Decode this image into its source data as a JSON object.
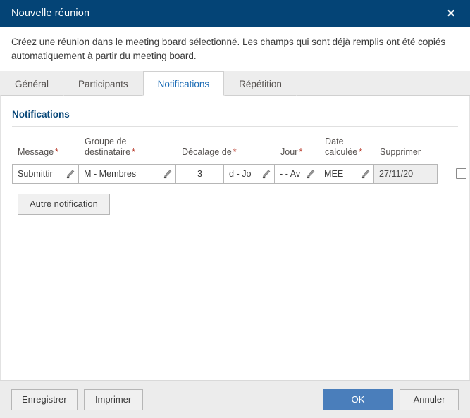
{
  "window": {
    "title": "Nouvelle réunion",
    "close_icon": "close-icon",
    "close_glyph": "✕"
  },
  "description": "Créez une réunion dans le meeting board sélectionné. Les champs qui sont déjà remplis ont été copiés automatiquement à partir du meeting board.",
  "tabs": [
    {
      "label": "Général",
      "active": false
    },
    {
      "label": "Participants",
      "active": false
    },
    {
      "label": "Notifications",
      "active": true
    },
    {
      "label": "Répétition",
      "active": false
    }
  ],
  "section": {
    "title": "Notifications"
  },
  "table": {
    "headers": [
      {
        "label": "Message",
        "required": true
      },
      {
        "label": "Groupe de destinataire",
        "required": true
      },
      {
        "label": "Décalage de",
        "required": true
      },
      {
        "label": "",
        "required": false
      },
      {
        "label": "Jour",
        "required": true
      },
      {
        "label": "Date calculée",
        "required": true
      },
      {
        "label": "Supprimer",
        "required": false
      }
    ],
    "rows": [
      {
        "message": "Submittir",
        "recipient_group": "M - Membres",
        "offset_number": "3",
        "offset_unit": "d - Jo",
        "direction": "- - Av",
        "day": "MEE",
        "calculated_date": "27/11/20",
        "delete_checked": false
      }
    ]
  },
  "actions": {
    "add_notification": "Autre notification"
  },
  "footer": {
    "save": "Enregistrer",
    "print": "Imprimer",
    "ok": "OK",
    "cancel": "Annuler"
  },
  "colors": {
    "titlebar": "#044476",
    "accent": "#1a6bb5",
    "primary_button": "#4a7ebb",
    "required_marker": "#b83a2b",
    "section_heading": "#044476"
  },
  "icons": {
    "edit": "pencil-icon"
  }
}
